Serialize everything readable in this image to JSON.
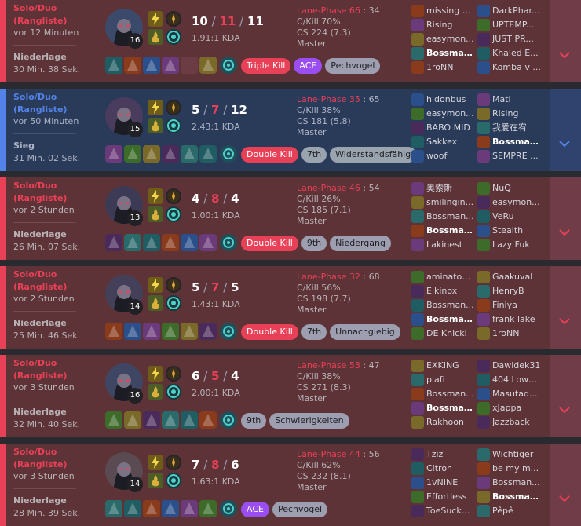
{
  "labels": {
    "queue_line1": "Solo/Duo",
    "queue_line2": "(Rangliste)",
    "kda_suffix": "KDA",
    "lane_phase": "Lane-Phase",
    "ckill": "C/Kill",
    "cs": "CS",
    "tier": "Master"
  },
  "icons": {
    "expand": "chevron-down-icon",
    "spells": [
      "flash-spell-icon",
      "ignite-spell-icon"
    ],
    "runes": [
      "keystone-rune-icon",
      "secondary-rune-icon"
    ]
  },
  "colors": {
    "loss_bg": "#5d3337",
    "win_bg": "#2a3a59",
    "loss_accent": "#e84057",
    "win_accent": "#5383e8",
    "badge_red": "#e84057",
    "badge_purple": "#9a4ef1",
    "badge_gray": "#9e9eb1"
  },
  "matches": [
    {
      "result": "loss",
      "time_ago": "vor 12 Minuten",
      "outcome": "Niederlage",
      "duration": "30 Min. 38 Sek.",
      "level": "16",
      "kills": "10",
      "deaths": "11",
      "assists": "11",
      "kda_ratio": "1.91:1",
      "lane_phase_a": "66",
      "lane_phase_b": "34",
      "ckill": "70%",
      "cs": "224 (7.3)",
      "items": [
        "item",
        "item",
        "item",
        "item",
        "empty",
        "item"
      ],
      "badges": [
        {
          "text": "Triple Kill",
          "style": "red"
        },
        {
          "text": "ACE",
          "style": "purple"
        },
        {
          "text": "Pechvogel",
          "style": "gray"
        }
      ],
      "team1": [
        "missing h...",
        "Rising",
        "easymon...",
        "Bossman...",
        "1roNN"
      ],
      "team2": [
        "DarkPhar...",
        "UPTEMP...",
        "JUST PR...",
        "Khaled E...",
        "Komba v ..."
      ],
      "me_team": 1,
      "me_index": 3
    },
    {
      "result": "win",
      "time_ago": "vor 50 Minuten",
      "outcome": "Sieg",
      "duration": "31 Min. 02 Sek.",
      "level": "15",
      "kills": "5",
      "deaths": "7",
      "assists": "12",
      "kda_ratio": "2.43:1",
      "lane_phase_a": "35",
      "lane_phase_b": "65",
      "ckill": "38%",
      "cs": "181 (5.8)",
      "items": [
        "item",
        "item",
        "item",
        "item",
        "item",
        "item"
      ],
      "badges": [
        {
          "text": "Double Kill",
          "style": "red"
        },
        {
          "text": "7th",
          "style": "gray"
        },
        {
          "text": "Widerstandsfähig",
          "style": "gray"
        }
      ],
      "team1": [
        "hidonbus",
        "easymon...",
        "BABO MID",
        "Sakkex",
        "woof"
      ],
      "team2": [
        "Mati",
        "Rising",
        "我爱在宥",
        "Bossman...",
        "SEMPRE ..."
      ],
      "me_team": 2,
      "me_index": 3
    },
    {
      "result": "loss",
      "time_ago": "vor 2 Stunden",
      "outcome": "Niederlage",
      "duration": "26 Min. 07 Sek.",
      "level": "13",
      "kills": "4",
      "deaths": "8",
      "assists": "4",
      "kda_ratio": "1.00:1",
      "lane_phase_a": "46",
      "lane_phase_b": "54",
      "ckill": "26%",
      "cs": "185 (7.1)",
      "items": [
        "item",
        "item",
        "item",
        "item",
        "item",
        "item"
      ],
      "badges": [
        {
          "text": "Double Kill",
          "style": "red"
        },
        {
          "text": "9th",
          "style": "gray"
        },
        {
          "text": "Niedergang",
          "style": "gray"
        }
      ],
      "team1": [
        "奥索斯",
        "smilingin...",
        "Bossman...",
        "Bossman...",
        "Lakinest"
      ],
      "team2": [
        "NuQ",
        "easymon...",
        "VeRu",
        "Stealth",
        "Lazy Fuk"
      ],
      "me_team": 1,
      "me_index": 3
    },
    {
      "result": "loss",
      "time_ago": "vor 2 Stunden",
      "outcome": "Niederlage",
      "duration": "25 Min. 46 Sek.",
      "level": "14",
      "kills": "5",
      "deaths": "7",
      "assists": "5",
      "kda_ratio": "1.43:1",
      "lane_phase_a": "32",
      "lane_phase_b": "68",
      "ckill": "56%",
      "cs": "198 (7.7)",
      "items": [
        "item",
        "item",
        "item",
        "item",
        "item",
        "item"
      ],
      "badges": [
        {
          "text": "Double Kill",
          "style": "red"
        },
        {
          "text": "7th",
          "style": "gray"
        },
        {
          "text": "Unnachgiebig",
          "style": "gray"
        }
      ],
      "team1": [
        "aminatoo...",
        "Elkinox",
        "Bossman...",
        "Bossman...",
        "DE Knicki"
      ],
      "team2": [
        "Gaakuval",
        "HenryB",
        "Finiya",
        "frank lake",
        "1roNN"
      ],
      "me_team": 1,
      "me_index": 3
    },
    {
      "result": "loss",
      "time_ago": "vor 3 Stunden",
      "outcome": "Niederlage",
      "duration": "32 Min. 40 Sek.",
      "level": "16",
      "kills": "6",
      "deaths": "5",
      "assists": "4",
      "kda_ratio": "2.00:1",
      "lane_phase_a": "53",
      "lane_phase_b": "47",
      "ckill": "38%",
      "cs": "271 (8.3)",
      "items": [
        "item",
        "item",
        "item",
        "item",
        "item",
        "item"
      ],
      "badges": [
        {
          "text": "9th",
          "style": "gray"
        },
        {
          "text": "Schwierigkeiten",
          "style": "gray"
        }
      ],
      "team1": [
        "EXKING",
        "plafi",
        "Bossman...",
        "Bossman...",
        "Rakhoon"
      ],
      "team2": [
        "Dawidek31",
        "404 Lowk...",
        "Masutad...",
        "xJappa",
        "Jazzback"
      ],
      "me_team": 1,
      "me_index": 3
    },
    {
      "result": "loss",
      "time_ago": "vor 3 Stunden",
      "outcome": "Niederlage",
      "duration": "28 Min. 39 Sek.",
      "level": "14",
      "kills": "7",
      "deaths": "8",
      "assists": "6",
      "kda_ratio": "1.63:1",
      "lane_phase_a": "44",
      "lane_phase_b": "56",
      "ckill": "62%",
      "cs": "232 (8.1)",
      "items": [
        "item",
        "item",
        "item",
        "item",
        "item",
        "item"
      ],
      "badges": [
        {
          "text": "ACE",
          "style": "purple"
        },
        {
          "text": "Pechvogel",
          "style": "gray"
        }
      ],
      "team1": [
        "Tziz",
        "Citron",
        "1vNINE",
        "Effortless",
        "ToeSuck..."
      ],
      "team2": [
        "Wichtiger",
        "be my m...",
        "Bossman...",
        "Bossman...",
        "Pêpê"
      ],
      "me_team": 2,
      "me_index": 3
    }
  ]
}
